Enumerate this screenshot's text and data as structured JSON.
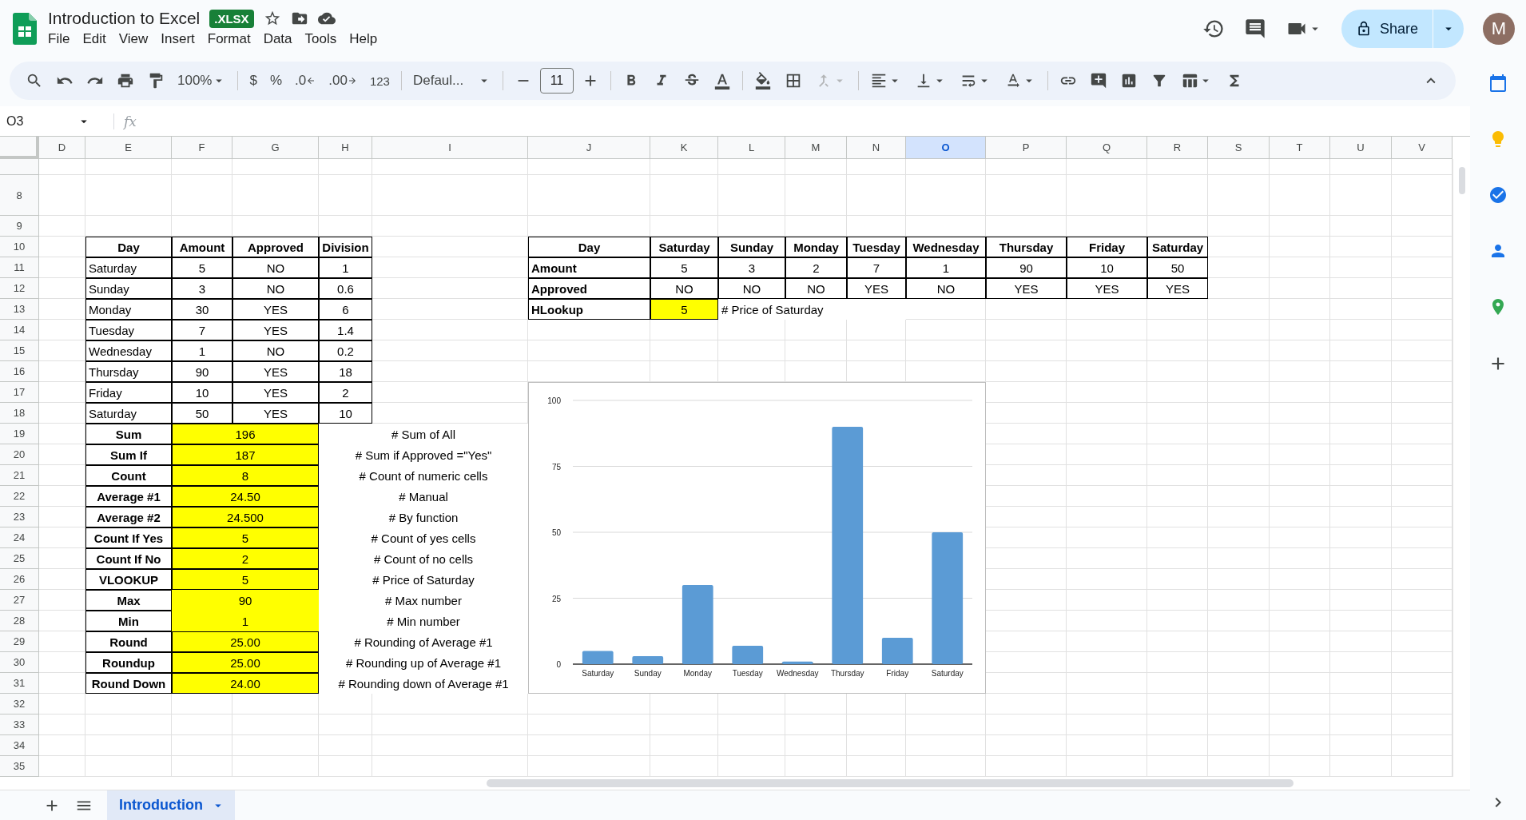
{
  "app": {
    "title": "Introduction to Excel",
    "badge": ".XLSX",
    "menus": [
      "File",
      "Edit",
      "View",
      "Insert",
      "Format",
      "Data",
      "Tools",
      "Help"
    ],
    "share": "Share",
    "avatar": "M"
  },
  "toolbar": {
    "zoom": "100%",
    "currency": "$",
    "percent": "%",
    "decrease_decimal": ".0",
    "increase_decimal": ".00",
    "number_format": "123",
    "font": "Defaul...",
    "font_size": "11",
    "merge": {
      "disabled": true
    }
  },
  "formula_bar": {
    "cell": "O3",
    "fx": "fx"
  },
  "columns": [
    {
      "label": "D",
      "selected": false
    },
    {
      "label": "E",
      "selected": false
    },
    {
      "label": "F",
      "selected": false
    },
    {
      "label": "G",
      "selected": false
    },
    {
      "label": "H",
      "selected": false
    },
    {
      "label": "I",
      "selected": false
    },
    {
      "label": "J",
      "selected": false
    },
    {
      "label": "K",
      "selected": false
    },
    {
      "label": "L",
      "selected": false
    },
    {
      "label": "M",
      "selected": false
    },
    {
      "label": "N",
      "selected": false
    },
    {
      "label": "O",
      "selected": true
    },
    {
      "label": "P",
      "selected": false
    },
    {
      "label": "Q",
      "selected": false
    },
    {
      "label": "R",
      "selected": false
    },
    {
      "label": "S",
      "selected": false
    },
    {
      "label": "T",
      "selected": false
    },
    {
      "label": "U",
      "selected": false
    },
    {
      "label": "V",
      "selected": false
    }
  ],
  "row_numbers": [
    "8",
    "9",
    "10",
    "11",
    "12",
    "13",
    "14",
    "15",
    "16",
    "17",
    "18",
    "19",
    "20",
    "21",
    "22",
    "23",
    "24",
    "25",
    "26",
    "27",
    "28",
    "29",
    "30",
    "31",
    "32",
    "33",
    "34",
    "35"
  ],
  "day_table": {
    "headers": [
      "Day",
      "Amount",
      "Approved",
      "Division"
    ],
    "rows": [
      [
        "Saturday",
        "5",
        "NO",
        "1"
      ],
      [
        "Sunday",
        "3",
        "NO",
        "0.6"
      ],
      [
        "Monday",
        "30",
        "YES",
        "6"
      ],
      [
        "Tuesday",
        "7",
        "YES",
        "1.4"
      ],
      [
        "Wednesday",
        "1",
        "NO",
        "0.2"
      ],
      [
        "Thursday",
        "90",
        "YES",
        "18"
      ],
      [
        "Friday",
        "10",
        "YES",
        "2"
      ],
      [
        "Saturday",
        "50",
        "YES",
        "10"
      ]
    ]
  },
  "summary": [
    {
      "label": "Sum",
      "value": "196",
      "note": "# Sum of All",
      "boxed": true
    },
    {
      "label": "Sum If",
      "value": "187",
      "note": "# Sum if Approved =\"Yes\"",
      "boxed": true
    },
    {
      "label": "Count",
      "value": "8",
      "note": "# Count of numeric cells",
      "boxed": true
    },
    {
      "label": "Average #1",
      "value": "24.50",
      "note": "# Manual",
      "boxed": true
    },
    {
      "label": "Average #2",
      "value": "24.500",
      "note": "# By function",
      "boxed": true
    },
    {
      "label": "Count If Yes",
      "value": "5",
      "note": "# Count of yes cells",
      "boxed": true
    },
    {
      "label": "Count If No",
      "value": "2",
      "note": "# Count of no cells",
      "boxed": true
    },
    {
      "label": "VLOOKUP",
      "value": "5",
      "note": "# Price of Saturday",
      "boxed": true
    },
    {
      "label": "Max",
      "value": "90",
      "note": "# Max number",
      "boxed": false
    },
    {
      "label": "Min",
      "value": "1",
      "note": "# Min number",
      "boxed": false
    },
    {
      "label": "Round",
      "value": "25.00",
      "note": "# Rounding of Average #1",
      "boxed": true
    },
    {
      "label": "Roundup",
      "value": "25.00",
      "note": "# Rounding up of Average #1",
      "boxed": true
    },
    {
      "label": "Round Down",
      "value": "24.00",
      "note": "# Rounding down of Average #1",
      "boxed": true
    }
  ],
  "hlookup_table": {
    "header": {
      "label": "Day",
      "cells": [
        "Saturday",
        "Sunday",
        "Monday",
        "Tuesday",
        "Wednesday",
        "Thursday",
        "Friday",
        "Saturday"
      ]
    },
    "rows": [
      {
        "label": "Amount",
        "cells": [
          "5",
          "3",
          "2",
          "7",
          "1",
          "90",
          "10",
          "50"
        ]
      },
      {
        "label": "Approved",
        "cells": [
          "NO",
          "NO",
          "NO",
          "YES",
          "NO",
          "YES",
          "YES",
          "YES"
        ]
      }
    ],
    "lookup": {
      "label": "HLookup",
      "value": "5",
      "note": "# Price of Saturday"
    }
  },
  "chart": {
    "chart_data": {
      "type": "bar",
      "categories": [
        "Saturday",
        "Sunday",
        "Monday",
        "Tuesday",
        "Wednesday",
        "Thursday",
        "Friday",
        "Saturday"
      ],
      "series": [
        {
          "color": "#5b9bd5",
          "values": [
            5,
            3,
            30,
            7,
            1,
            90,
            10,
            50
          ]
        }
      ],
      "ylim": [
        0,
        100
      ],
      "grid": true,
      "yticks": [
        0,
        25,
        50,
        75,
        100
      ]
    }
  },
  "sheets": [
    {
      "label": "Introduction",
      "selected": true
    }
  ]
}
